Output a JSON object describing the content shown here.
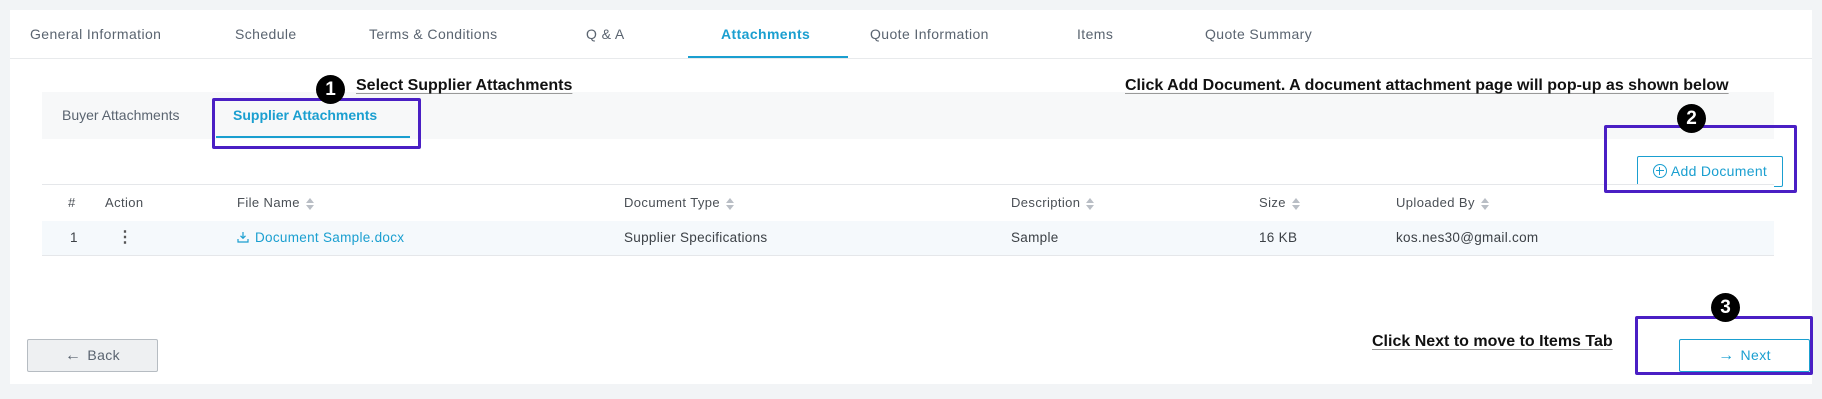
{
  "tabs": [
    {
      "label": "General Information"
    },
    {
      "label": "Schedule"
    },
    {
      "label": "Terms & Conditions"
    },
    {
      "label": "Q & A"
    },
    {
      "label": "Attachments"
    },
    {
      "label": "Quote Information"
    },
    {
      "label": "Items"
    },
    {
      "label": "Quote Summary"
    }
  ],
  "active_tab": "Attachments",
  "subtabs": [
    {
      "label": "Buyer Attachments"
    },
    {
      "label": "Supplier Attachments"
    }
  ],
  "active_subtab": "Supplier Attachments",
  "add_document_label": "Add Document",
  "table": {
    "headers": [
      "#",
      "Action",
      "File Name",
      "Document Type",
      "Description",
      "Size",
      "Uploaded By"
    ],
    "rows": [
      {
        "num": "1",
        "action_icon": "kebab-menu-icon",
        "file_name": "Document Sample.docx",
        "document_type": "Supplier Specifications",
        "description": "Sample",
        "size": "16 KB",
        "uploaded_by": "kos.nes30@gmail.com"
      }
    ]
  },
  "back_label": "Back",
  "next_label": "Next",
  "annotations": {
    "step1_number": "1",
    "step1_text": "Select Supplier Attachments",
    "step2_number": "2",
    "step2_text": "Click Add Document. A document attachment page will pop-up as shown below",
    "step3_number": "3",
    "step3_text": "Click Next to move to Items Tab"
  },
  "colors": {
    "accent": "#1a9fd0",
    "highlight": "#4a1fc4",
    "background": "#f2f4f6"
  }
}
